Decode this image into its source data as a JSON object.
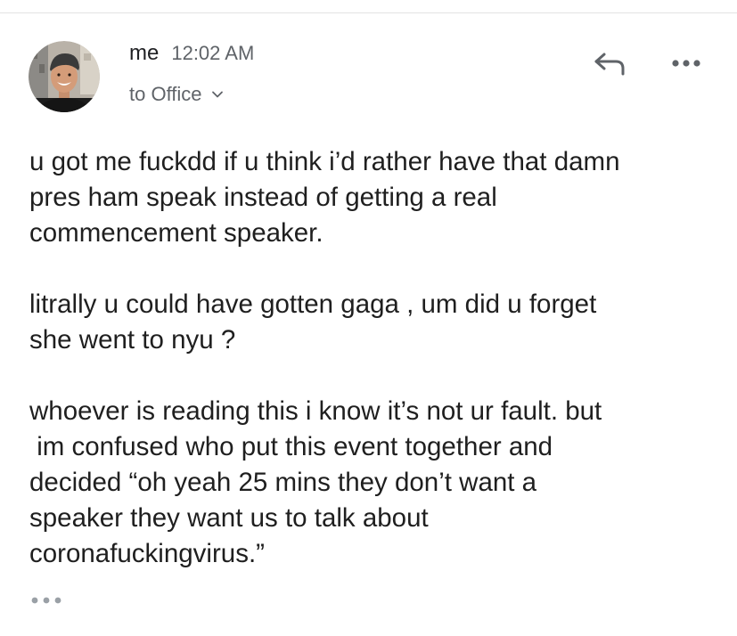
{
  "header": {
    "sender": "me",
    "time": "12:02 AM",
    "recipient": "to Office"
  },
  "message": {
    "paragraphs": [
      "u got me fuckdd if u think i’d rather have that damn\npres ham speak instead of getting a real\ncommencement speaker.",
      "litrally u could have gotten gaga , um did u forget\nshe went to nyu ?",
      "whoever is reading this i know it’s not ur fault. but\n im confused who put this event together and\ndecided “oh yeah 25 mins they don’t want a\nspeaker they want us to talk about\ncoronafuckingvirus.”"
    ]
  },
  "icons": {
    "avatar": "avatar-photo",
    "reply": "reply-arrow-icon",
    "more": "more-horizontal-icon",
    "recipient_toggle": "chevron-down-icon",
    "trimmed_content": "ellipsis-icon"
  },
  "colors": {
    "text_primary": "#1f1f1f",
    "text_secondary": "#5f6368",
    "icon": "#5f6368",
    "divider": "#e3e3e3"
  }
}
